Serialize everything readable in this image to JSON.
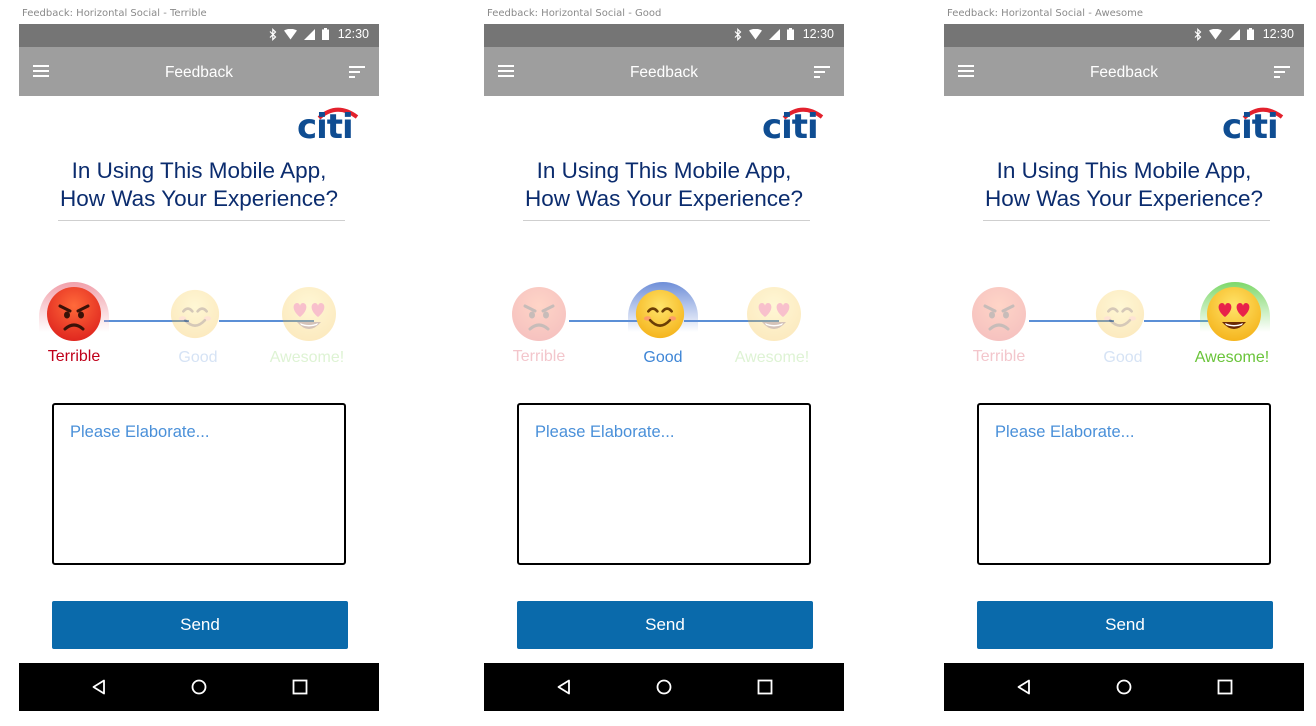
{
  "panels": [
    {
      "caption": "Feedback: Horizontal Social - Terrible",
      "selected": "terrible",
      "status_time": "12:30",
      "appbar_title": "Feedback",
      "logo_text": "citi",
      "heading_line1": "In Using This Mobile App,",
      "heading_line2": "How Was Your Experience?",
      "ratings": {
        "terrible": "Terrible",
        "good": "Good",
        "awesome": "Awesome!"
      },
      "textarea_placeholder": "Please Elaborate...",
      "send_label": "Send"
    },
    {
      "caption": "Feedback: Horizontal Social - Good",
      "selected": "good",
      "status_time": "12:30",
      "appbar_title": "Feedback",
      "logo_text": "citi",
      "heading_line1": "In Using This Mobile App,",
      "heading_line2": "How Was Your Experience?",
      "ratings": {
        "terrible": "Terrible",
        "good": "Good",
        "awesome": "Awesome!"
      },
      "textarea_placeholder": "Please Elaborate...",
      "send_label": "Send"
    },
    {
      "caption": "Feedback: Horizontal Social - Awesome",
      "selected": "awesome",
      "status_time": "12:30",
      "appbar_title": "Feedback",
      "logo_text": "citi",
      "heading_line1": "In Using This Mobile App,",
      "heading_line2": "How Was Your Experience?",
      "ratings": {
        "terrible": "Terrible",
        "good": "Good",
        "awesome": "Awesome!"
      },
      "textarea_placeholder": "Please Elaborate...",
      "send_label": "Send"
    }
  ],
  "icons": {
    "status": [
      "bluetooth-icon",
      "wifi-icon",
      "signal-icon",
      "battery-icon"
    ],
    "appbar": [
      "menu-icon",
      "filter-icon"
    ],
    "nav": [
      "back-icon",
      "home-icon",
      "recents-icon"
    ],
    "faces": [
      "angry-face-icon",
      "smiling-face-icon",
      "heart-eyes-face-icon"
    ]
  },
  "colors": {
    "status_bar": "#757575",
    "app_bar": "#9e9e9e",
    "heading": "#0b2c6e",
    "citi_blue": "#0f4d92",
    "citi_red": "#e3212d",
    "track": "#5b8fd6",
    "send_button": "#0a6aab",
    "terrible_label": "#c0001a",
    "good_label": "#3f86d6",
    "awesome_label": "#6ac43a",
    "placeholder": "#4a90d9"
  }
}
